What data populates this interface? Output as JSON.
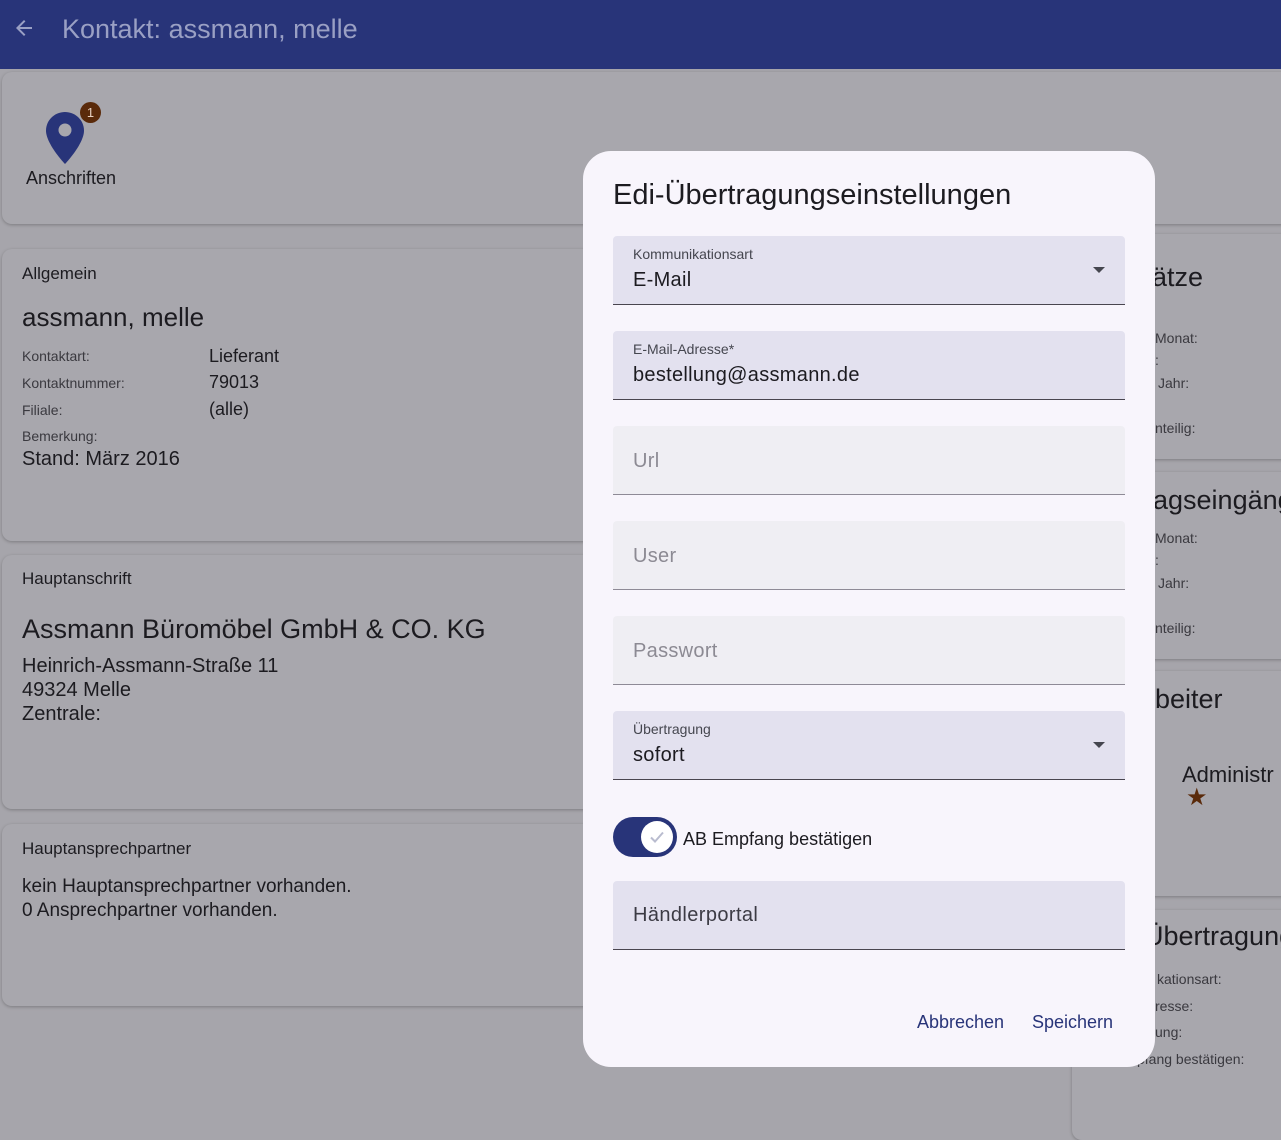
{
  "appbar": {
    "title": "Kontakt: assmann, melle"
  },
  "addresses": {
    "label": "Anschriften",
    "badge": "1"
  },
  "allgemein": {
    "heading": "Allgemein",
    "name": "assmann, melle",
    "rows": [
      {
        "label": "Kontaktart:",
        "value": "Lieferant"
      },
      {
        "label": "Kontaktnummer:",
        "value": "79013"
      },
      {
        "label": "Filiale:",
        "value": "(alle)"
      }
    ],
    "remark_label": "Bemerkung:",
    "remark_value": "Stand: März 2016"
  },
  "hauptanschrift": {
    "heading": "Hauptanschrift",
    "company": "Assmann Büromöbel GmbH & CO. KG",
    "street": "Heinrich-Assmann-Straße 11",
    "city": "49324 Melle",
    "extra": "Zentrale:"
  },
  "hauptansprechpartner": {
    "heading": "Hauptansprechpartner",
    "line1": "kein Hauptansprechpartner vorhanden.",
    "line2": "0 Ansprechpartner vorhanden."
  },
  "right_column": {
    "umsaetze": {
      "heading": "ätze",
      "l1": "Monat:",
      "l2": ":",
      "l3": "Jahr:",
      "l4": "nteilig:"
    },
    "auftragseingaenge": {
      "heading": "agseingänge",
      "l1": "Monat:",
      "l2": ":",
      "l3": "Jahr:",
      "l4": "nteilig:"
    },
    "mitarbeiter": {
      "heading": "beiter",
      "name": "Administr",
      "star": "★"
    },
    "uebertragung": {
      "heading": "Übertragung",
      "l1": "kationsart:",
      "l2": "resse:",
      "l3": "ung:",
      "l4": "pfang bestätigen:"
    }
  },
  "dialog": {
    "title": "Edi-Übertragungseinstellungen",
    "kommunikationsart": {
      "label": "Kommunikationsart",
      "value": "E-Mail"
    },
    "email": {
      "label": "E-Mail-Adresse*",
      "value": "bestellung@assmann.de"
    },
    "url": {
      "placeholder": "Url"
    },
    "user": {
      "placeholder": "User"
    },
    "passwort": {
      "placeholder": "Passwort"
    },
    "uebertragung": {
      "label": "Übertragung",
      "value": "sofort"
    },
    "ab_toggle": {
      "label": "AB Empfang bestätigen",
      "checked": true
    },
    "haendlerportal": {
      "label": "Händlerportal"
    },
    "cancel_label": "Abbrechen",
    "save_label": "Speichern"
  },
  "colors": {
    "primary": "#283479",
    "badge": "#5a2a0a",
    "scrim": "#a6a5ab",
    "dialog_bg": "#f8f5fc"
  }
}
